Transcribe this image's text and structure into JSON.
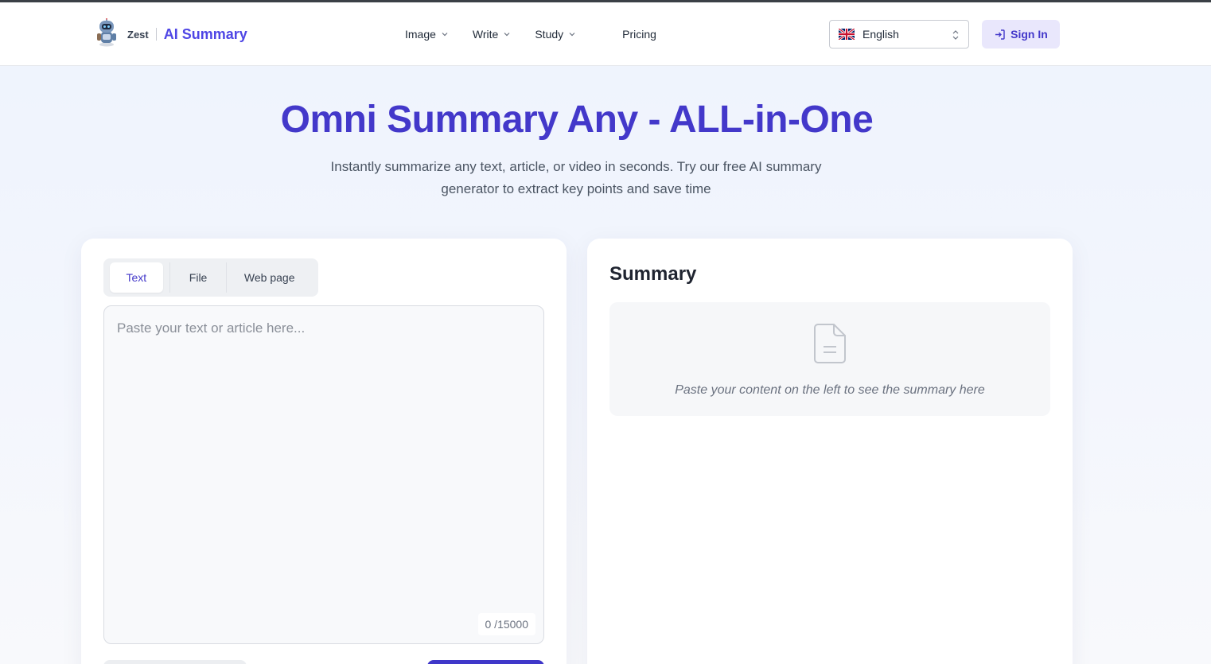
{
  "header": {
    "brand_small": "Zest",
    "brand_title": "AI Summary",
    "nav": [
      {
        "label": "Image"
      },
      {
        "label": "Write"
      },
      {
        "label": "Study"
      },
      {
        "label": "Pricing"
      }
    ],
    "language": "English",
    "signin_label": "Sign In"
  },
  "hero": {
    "title": "Omni Summary Any - ALL-in-One",
    "subtitle": "Instantly summarize any text, article, or video in seconds. Try our free AI summary generator to extract key points and save time"
  },
  "input_panel": {
    "tabs": [
      {
        "label": "Text",
        "active": true
      },
      {
        "label": "File"
      },
      {
        "label": "Web page"
      }
    ],
    "textarea_placeholder": "Paste your text or article here...",
    "textarea_value": "",
    "counter": "0 /15000"
  },
  "summary_panel": {
    "title": "Summary",
    "empty_message": "Paste your content on the left to see the summary here"
  },
  "colors": {
    "accent": "#4338ca",
    "signin_bg": "#e9e7fc",
    "primary_button": "#3f37c9"
  },
  "icons": {
    "logo": "robot-mascot-icon",
    "nav_chevron": "chevron-down-icon",
    "language_flag": "uk-flag-icon",
    "language_toggle": "chevron-up-down-icon",
    "signin": "sign-in-icon",
    "summary_placeholder": "document-icon"
  }
}
